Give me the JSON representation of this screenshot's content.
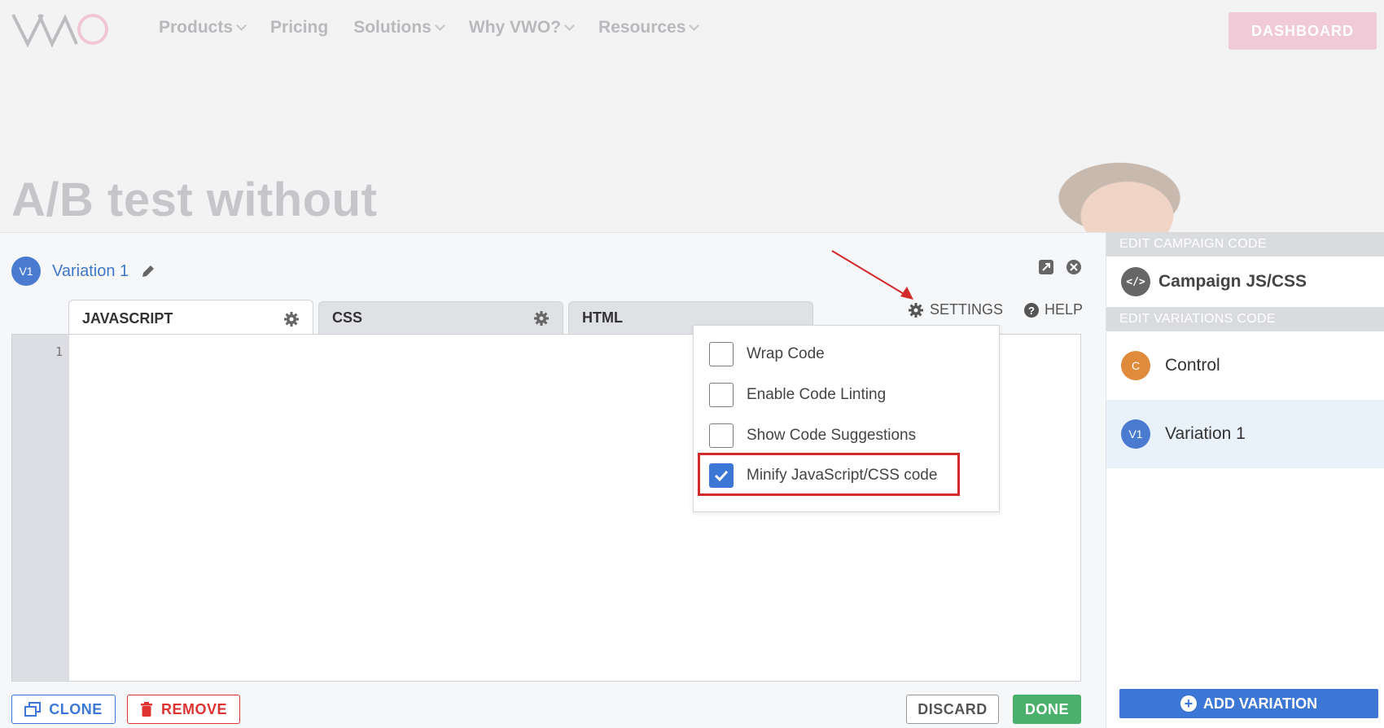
{
  "site": {
    "nav": [
      "Products",
      "Pricing",
      "Solutions",
      "Why VWO?",
      "Resources"
    ],
    "nav_has_dropdown": [
      true,
      false,
      true,
      true,
      true
    ],
    "dashboard_label": "DASHBOARD",
    "hero_text": "A/B test without"
  },
  "editor": {
    "variation_badge": "V1",
    "variation_name": "Variation 1",
    "tabs": [
      "JAVASCRIPT",
      "CSS",
      "HTML"
    ],
    "settings_label": "SETTINGS",
    "help_label": "HELP",
    "line_number": "1",
    "settings_options": [
      {
        "label": "Wrap Code",
        "checked": false
      },
      {
        "label": "Enable Code Linting",
        "checked": false
      },
      {
        "label": "Show Code Suggestions",
        "checked": false
      },
      {
        "label": "Minify JavaScript/CSS code",
        "checked": true
      }
    ],
    "buttons": {
      "clone": "CLONE",
      "remove": "REMOVE",
      "discard": "DISCARD",
      "done": "DONE"
    }
  },
  "right_panel": {
    "campaign_header": "EDIT CAMPAIGN CODE",
    "campaign_badge": "</>",
    "campaign_label": "Campaign JS/CSS",
    "variations_header": "EDIT VARIATIONS CODE",
    "variations": [
      {
        "badge": "C",
        "name": "Control",
        "selected": false
      },
      {
        "badge": "V1",
        "name": "Variation 1",
        "selected": true
      }
    ],
    "add_variation_label": "ADD VARIATION"
  },
  "colors": {
    "accent": "#3c77d6",
    "done": "#4bb06b",
    "remove": "#dd3333",
    "highlight": "#d22a2a",
    "control_badge": "#e08a3c"
  }
}
